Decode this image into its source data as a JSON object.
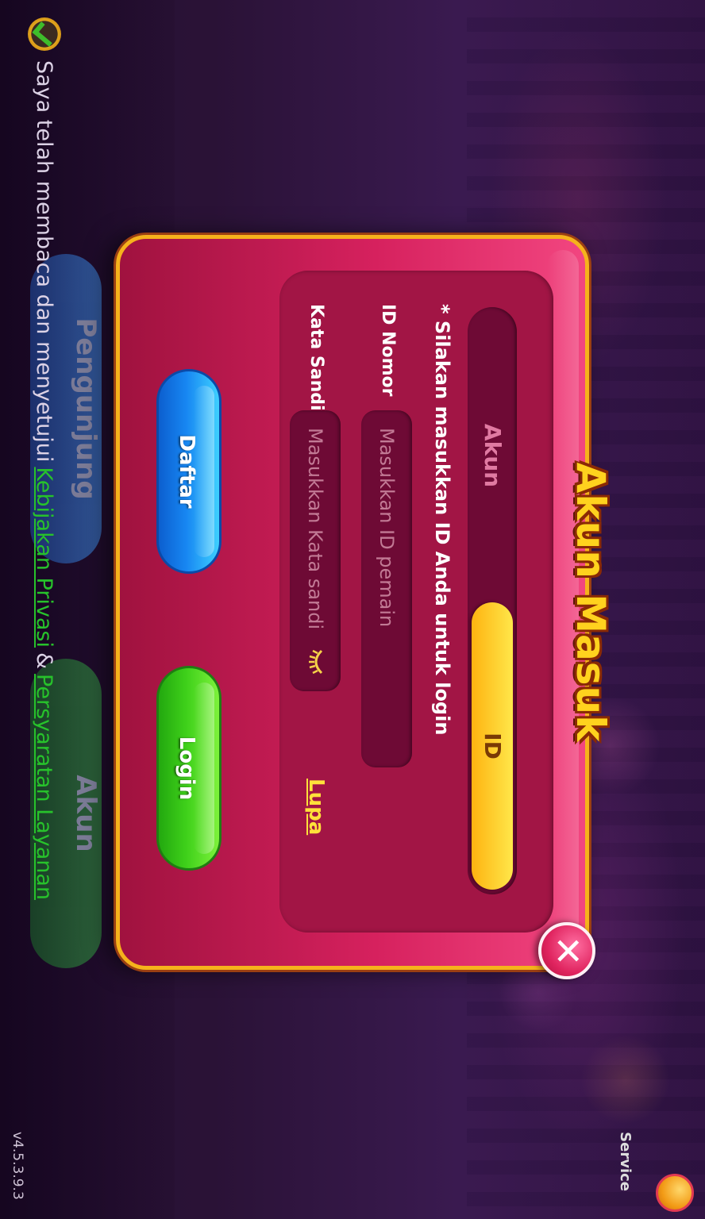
{
  "dialog": {
    "title": "Akun Masuk",
    "tabs": [
      {
        "label": "Akun",
        "active": false
      },
      {
        "label": "ID",
        "active": true
      }
    ],
    "notice": "* Silakan masukkan ID Anda untuk login",
    "id_label": "ID Nomor",
    "id_placeholder": "Masukkan ID pemain",
    "password_label": "Kata Sandi",
    "password_placeholder": "Masukkan Kata sandi",
    "forgot_label": "Lupa",
    "register_label": "Daftar",
    "login_label": "Login",
    "close_icon": "close-icon"
  },
  "background": {
    "button_left_label": "Pengunjung",
    "button_right_label": "Akun"
  },
  "footer": {
    "agreement_text": "Saya telah membaca dan menyetujui",
    "privacy_link": "Kebijakan Privasi",
    "ampersand": "&",
    "terms_link": "Persyaratan Layanan",
    "version": "v4.5.3.9.3",
    "service_label": "Service"
  },
  "colors": {
    "dialog_border": "#f6b21c",
    "title": "#ffd21e",
    "register_button": "#1786f2",
    "login_button": "#3ed01a",
    "link": "#27c22b"
  }
}
